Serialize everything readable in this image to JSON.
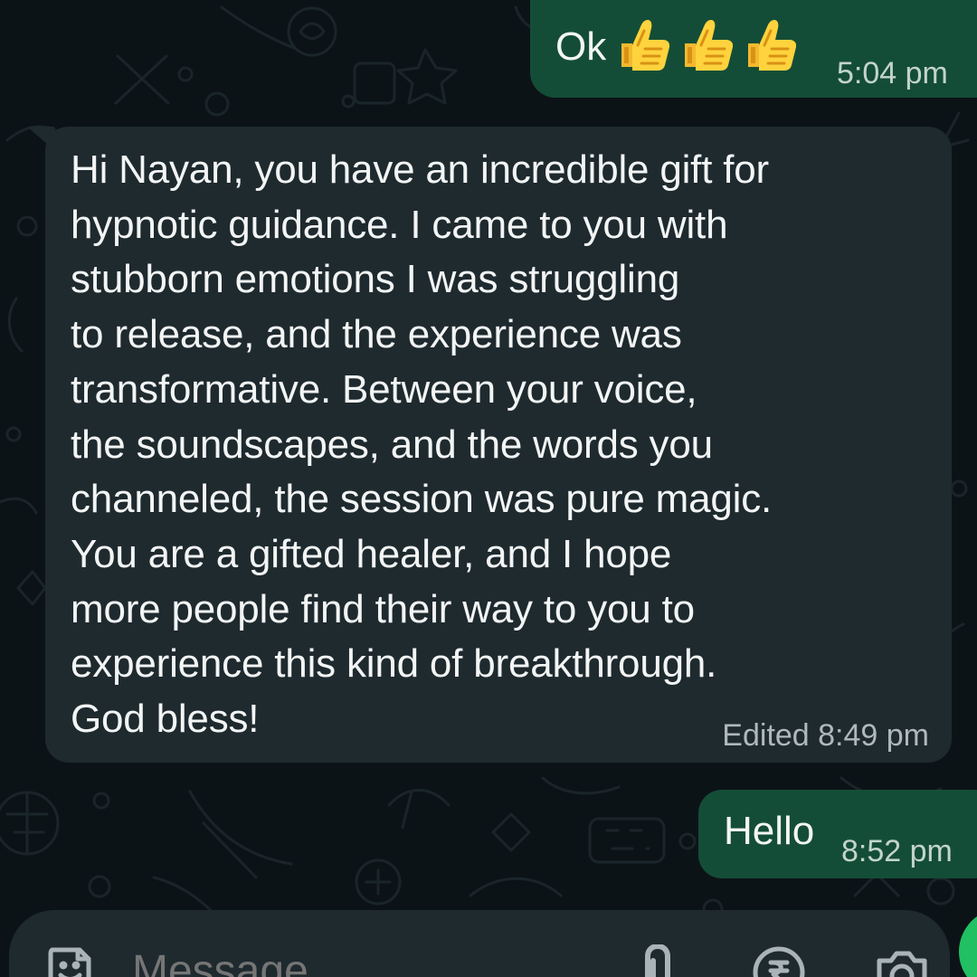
{
  "chat": {
    "messages": [
      {
        "direction": "outgoing",
        "text": "Ok",
        "emoji": [
          "thumbs-up",
          "thumbs-up",
          "thumbs-up"
        ],
        "time": "5:04 pm"
      },
      {
        "direction": "incoming",
        "text": "Hi Nayan, you have an incredible gift for\nhypnotic guidance. I came to you with\nstubborn emotions I was struggling\nto release, and the experience was\ntransformative. Between your voice,\nthe soundscapes, and the words you\nchanneled, the session was pure magic.\nYou are a gifted healer, and I hope\nmore people find their way to you to\nexperience this kind of breakthrough.\nGod bless!",
        "time": "Edited 8:49 pm"
      },
      {
        "direction": "outgoing",
        "text": "Hello",
        "time": "8:52 pm"
      }
    ]
  },
  "composer": {
    "placeholder": "Message",
    "icons": [
      "emoji-sticker-icon",
      "attach-icon",
      "rupee-payment-icon",
      "camera-icon"
    ]
  },
  "colors": {
    "background": "#0c1317",
    "incoming_bubble": "#1f2a2f",
    "outgoing_bubble": "#144d37",
    "text": "#f2f5f4",
    "timestamp_incoming": "#aeb8bd",
    "timestamp_outgoing": "#c3d4cc",
    "accent": "#21c063"
  }
}
